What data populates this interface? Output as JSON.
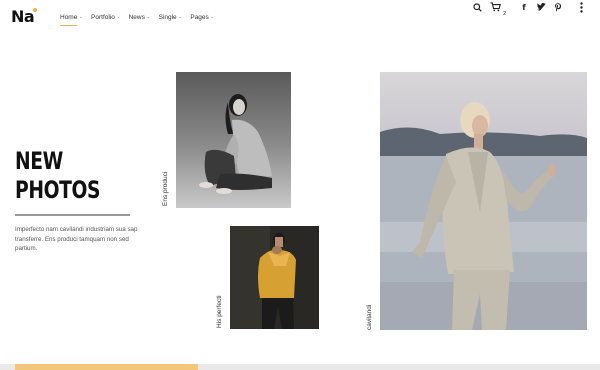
{
  "brand": {
    "logo_text": "Na",
    "accent_color": "#e8b04a"
  },
  "nav": {
    "items": [
      {
        "label": "Home",
        "active": true
      },
      {
        "label": "Portfolio",
        "active": false
      },
      {
        "label": "News",
        "active": false
      },
      {
        "label": "Single",
        "active": false
      },
      {
        "label": "Pages",
        "active": false
      }
    ],
    "chevron": "⌄"
  },
  "header_icons": {
    "search": "search-icon",
    "cart": "cart-icon",
    "cart_count": "2",
    "facebook": "f",
    "twitter": "twitter-icon",
    "pinterest": "pinterest-icon",
    "more": "more-icon"
  },
  "hero": {
    "title_line1": "NEW",
    "title_line2": "PHOTOS",
    "text": "Imperfecto nam cavilandi industriam sua sap transferre. Ens produci tamquam non sed partium."
  },
  "photos": [
    {
      "caption": "Ens produci"
    },
    {
      "caption": "His perfecti"
    },
    {
      "caption": "cavilandi"
    }
  ]
}
